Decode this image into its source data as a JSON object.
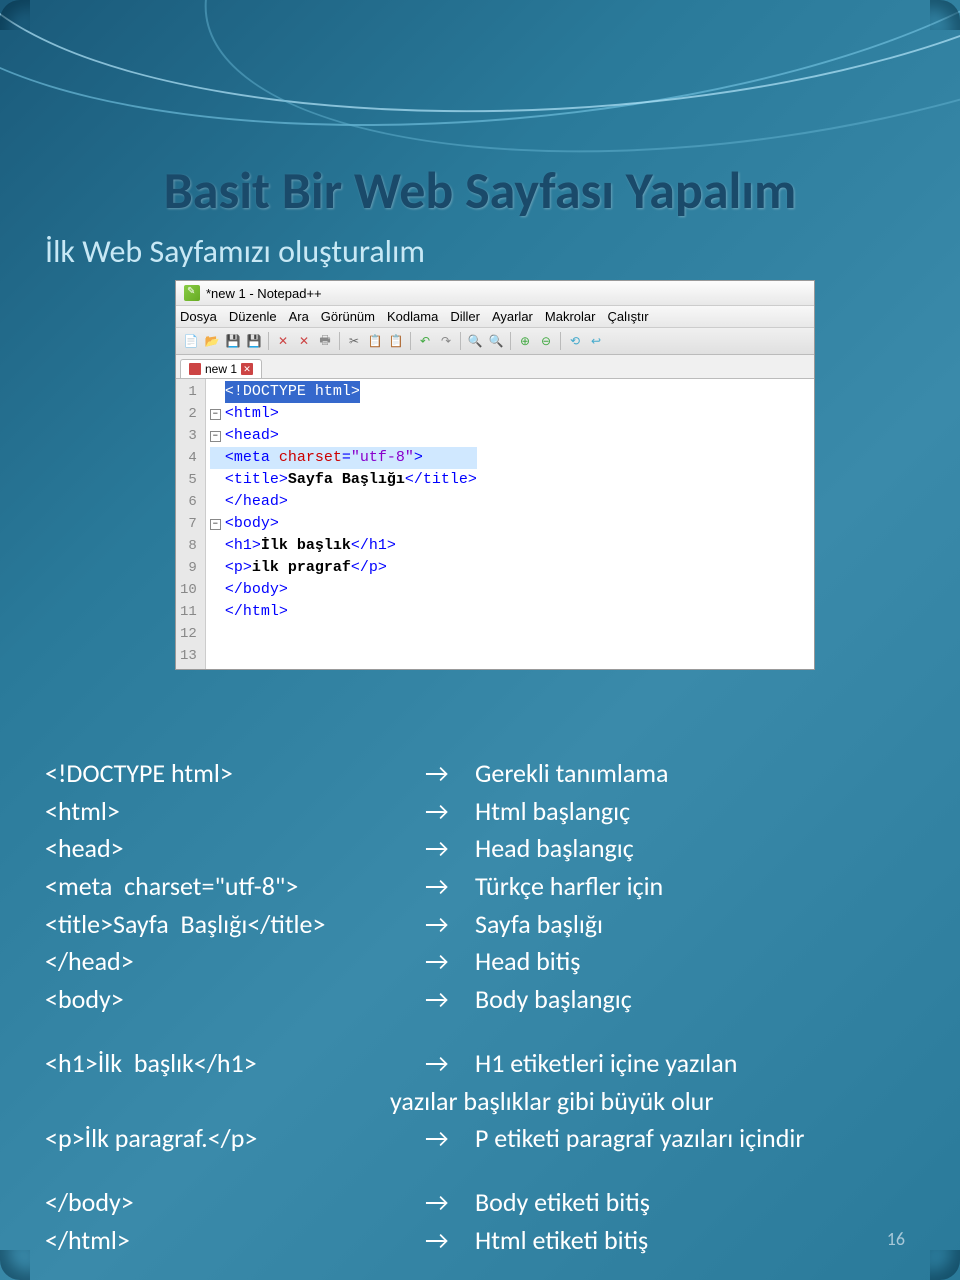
{
  "slide": {
    "title": "Basit Bir Web Sayfası Yapalım",
    "subtitle": "İlk Web Sayfamızı oluşturalım",
    "page_number": "16"
  },
  "editor": {
    "window_title": "*new 1 - Notepad++",
    "menus": [
      "Dosya",
      "Düzenle",
      "Ara",
      "Görünüm",
      "Kodlama",
      "Diller",
      "Ayarlar",
      "Makrolar",
      "Çalıştır"
    ],
    "tab_label": "new 1",
    "line_numbers": [
      "1",
      "2",
      "3",
      "4",
      "5",
      "6",
      "7",
      "8",
      "9",
      "10",
      "11",
      "12",
      "13"
    ]
  },
  "code": {
    "l1_sel": "<!DOCTYPE html>",
    "l2": "<html>",
    "l3": "<head>",
    "l4_t1": "<meta ",
    "l4_attr": "charset",
    "l4_eq": "=",
    "l4_val": "\"utf-8\"",
    "l4_t2": ">",
    "l5_o": "<title>",
    "l5_txt": "Sayfa Başlığı",
    "l5_c": "</title>",
    "l6": "</head>",
    "l7": "<body>",
    "l9_o": "<h1>",
    "l9_txt": "İlk başlık",
    "l9_c": "</h1>",
    "l10_o": "<p>",
    "l10_txt": "ilk pragraf",
    "l10_c": "</p>",
    "l12": "</body>",
    "l13": "</html>"
  },
  "explanations": [
    {
      "code": "<!DOCTYPE html>",
      "desc": "Gerekli  tanımlama"
    },
    {
      "code": "<html>",
      "desc": "Html  başlangıç"
    },
    {
      "code": "<head>",
      "desc": "Head  başlangıç"
    },
    {
      "code": "<meta  charset=\"utf-8\">",
      "desc": "Türkçe  harfler  için"
    },
    {
      "code": "<title>Sayfa  Başlığı</title>",
      "desc": "Sayfa  başlığı"
    },
    {
      "code": "</head>",
      "desc": "Head  bitiş"
    },
    {
      "code": "<body>",
      "desc": "Body  başlangıç"
    }
  ],
  "explanations2": [
    {
      "code": "<h1>İlk  başlık</h1>",
      "desc": "H1  etiketleri  içine  yazılan"
    },
    {
      "indent": "yazılar  başlıklar  gibi  büyük  olur"
    },
    {
      "code": "<p>İlk paragraf.</p>",
      "desc": "P  etiketi  paragraf  yazıları  içindir"
    }
  ],
  "explanations3": [
    {
      "code": "</body>",
      "desc": "Body  etiketi  bitiş"
    },
    {
      "code": "</html>",
      "desc": "Html  etiketi  bitiş"
    }
  ],
  "arrow": "→"
}
